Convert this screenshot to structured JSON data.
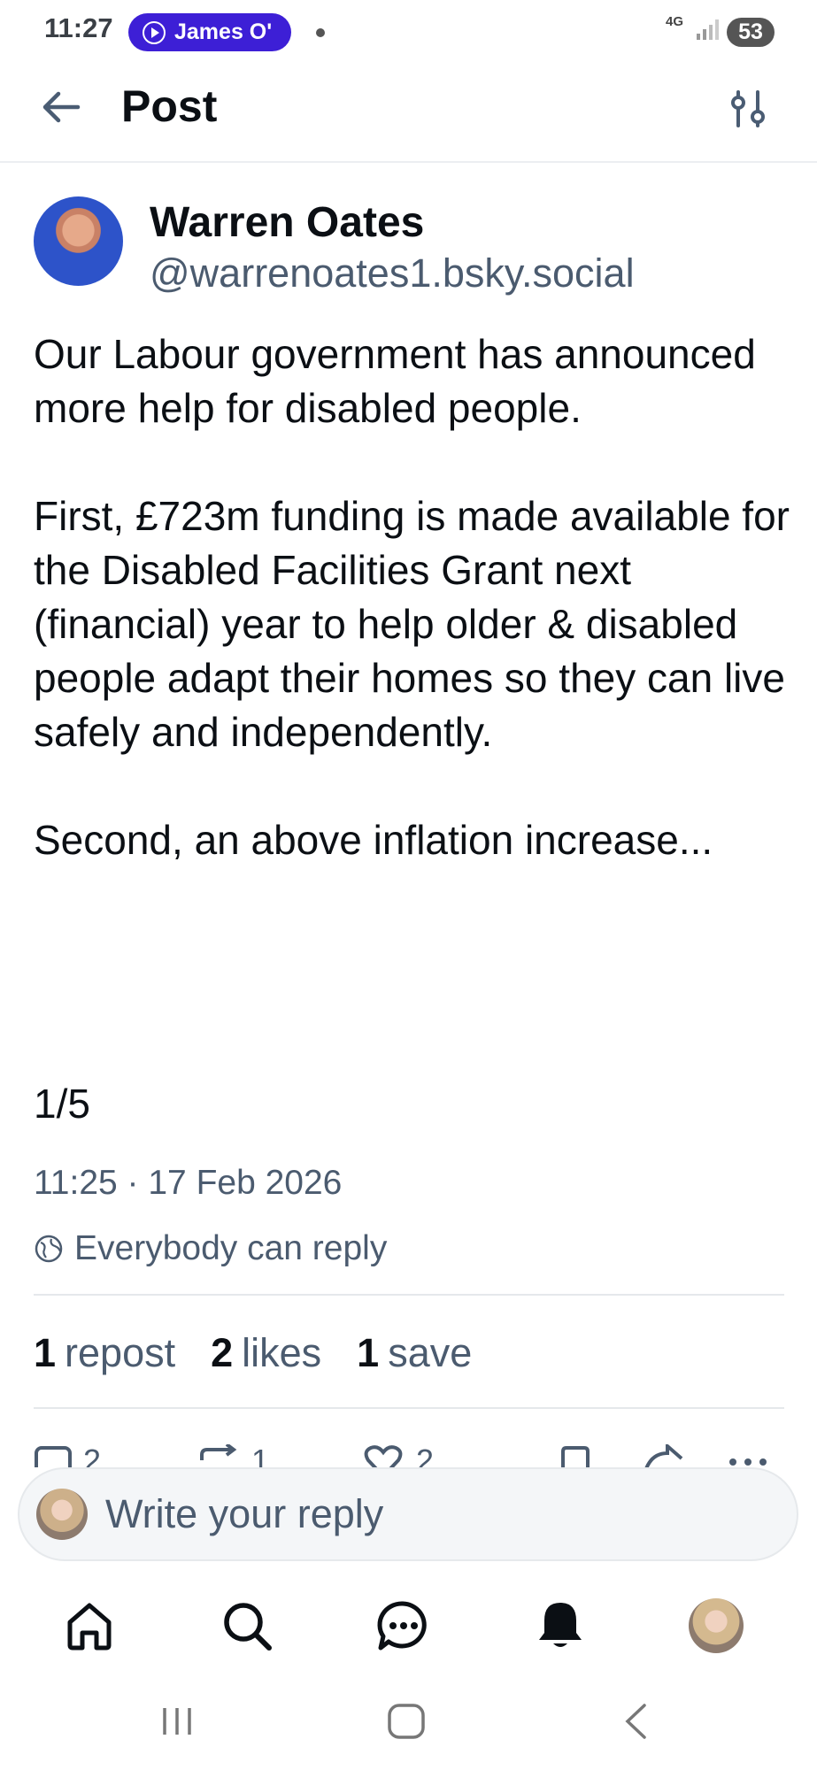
{
  "status_bar": {
    "time": "11:27",
    "media_pill": "James O'",
    "network": "4G",
    "battery": "53"
  },
  "header": {
    "title": "Post"
  },
  "post": {
    "author_name": "Warren Oates",
    "author_handle": "@warrenoates1.bsky.social",
    "text": "Our Labour government has announced more help for disabled people.\n\nFirst, £723m funding is made available for the Disabled Facilities Grant next (financial) year to help older & disabled people adapt their homes so they can live safely and independently.\n\nSecond, an above inflation increase...",
    "thread_count": "1/5",
    "timestamp": "11:25 · 17 Feb 2026",
    "reply_setting": "Everybody can reply",
    "stats": {
      "reposts_count": "1",
      "reposts_label": "repost",
      "likes_count": "2",
      "likes_label": "likes",
      "saves_count": "1",
      "saves_label": "save"
    },
    "actions": {
      "reply_count": "2",
      "repost_count": "1",
      "like_count": "2"
    }
  },
  "composer": {
    "placeholder": "Write your reply"
  },
  "bottom_nav": {
    "items": [
      "home-icon",
      "search-icon",
      "chat-icon",
      "notifications-icon",
      "profile-avatar"
    ]
  },
  "colors": {
    "accent_pill": "#3d1fd6",
    "secondary_text": "#4b5b6f"
  }
}
